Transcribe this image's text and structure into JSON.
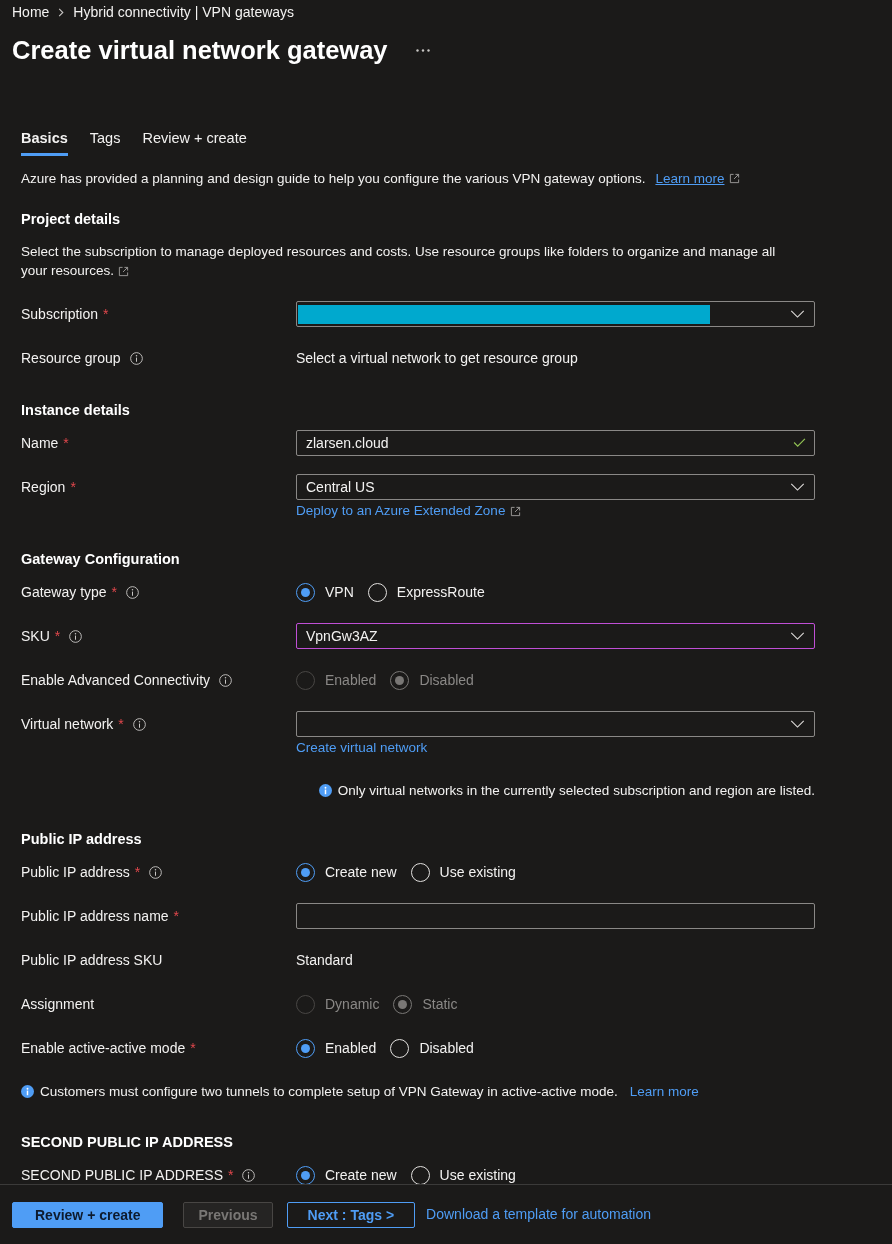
{
  "breadcrumb": [
    {
      "label": "Home"
    },
    {
      "label": "Hybrid connectivity | VPN gateways"
    }
  ],
  "title": "Create virtual network gateway",
  "tabs": [
    {
      "label": "Basics",
      "selected": true
    },
    {
      "label": "Tags",
      "selected": false
    },
    {
      "label": "Review + create",
      "selected": false
    }
  ],
  "intro": {
    "text": "Azure has provided a planning and design guide to help you configure the various VPN gateway options.",
    "link": {
      "label": "Learn more",
      "external": true
    }
  },
  "sections": [
    {
      "heading": "Project details",
      "description": {
        "text": "Select the subscription to manage deployed resources and costs. Use resource groups like folders to organize and manage all your resources.",
        "external": true
      },
      "rows": [
        {
          "kind": "dropdown",
          "label": "Subscription",
          "required_mark": "*",
          "redacted": true
        },
        {
          "kind": "static",
          "label": "Resource group",
          "info": true,
          "value": "Select a virtual network to get resource group"
        }
      ]
    },
    {
      "heading": "Instance details",
      "rows": [
        {
          "kind": "textbox",
          "label": "Name",
          "required_mark": "*",
          "value": "zlarsen.cloud",
          "valid": true
        },
        {
          "kind": "dropdown",
          "label": "Region",
          "required_mark": "*",
          "value": "Central US",
          "link": {
            "label": "Deploy to an Azure Extended Zone",
            "external": true
          }
        }
      ]
    },
    {
      "heading": "Gateway Configuration",
      "rows": [
        {
          "kind": "radio",
          "label": "Gateway type",
          "required_mark": "*",
          "info": true,
          "disabled": false,
          "options": [
            {
              "label": "VPN",
              "selected": true
            },
            {
              "label": "ExpressRoute",
              "selected": false
            }
          ]
        },
        {
          "kind": "dropdown",
          "label": "SKU",
          "required_mark": "*",
          "info": true,
          "value": "VpnGw3AZ",
          "focused": true
        },
        {
          "kind": "radio",
          "label": "Enable Advanced Connectivity",
          "info": true,
          "disabled": true,
          "options": [
            {
              "label": "Enabled",
              "selected": false
            },
            {
              "label": "Disabled",
              "selected": true
            }
          ]
        },
        {
          "kind": "dropdown",
          "label": "Virtual network",
          "required_mark": "*",
          "info": true,
          "link": {
            "label": "Create virtual network"
          },
          "note": {
            "text": "Only virtual networks in the currently selected subscription and region are listed."
          }
        }
      ]
    },
    {
      "heading": "Public IP address",
      "rows": [
        {
          "kind": "radio",
          "label": "Public IP address",
          "required_mark": "*",
          "info": true,
          "disabled": false,
          "options": [
            {
              "label": "Create new",
              "selected": true
            },
            {
              "label": "Use existing",
              "selected": false
            }
          ]
        },
        {
          "kind": "textbox",
          "label": "Public IP address name",
          "required_mark": "*"
        },
        {
          "kind": "static",
          "label": "Public IP address SKU",
          "value": "Standard"
        },
        {
          "kind": "radio",
          "label": "Assignment",
          "disabled": true,
          "options": [
            {
              "label": "Dynamic",
              "selected": false
            },
            {
              "label": "Static",
              "selected": true
            }
          ]
        },
        {
          "kind": "radio",
          "label": "Enable active-active mode",
          "required_mark": "*",
          "disabled": false,
          "options": [
            {
              "label": "Enabled",
              "selected": true
            },
            {
              "label": "Disabled",
              "selected": false
            }
          ]
        },
        {
          "kind": "note",
          "text": "Customers must configure two tunnels to complete setup of VPN Gateway in active-active mode.",
          "link": {
            "label": "Learn more"
          }
        }
      ]
    },
    {
      "heading": "SECOND PUBLIC IP ADDRESS",
      "rows": [
        {
          "kind": "radio",
          "label": "SECOND PUBLIC IP ADDRESS",
          "required_mark": "*",
          "info": true,
          "disabled": false,
          "options": [
            {
              "label": "Create new",
              "selected": true
            },
            {
              "label": "Use existing",
              "selected": false
            }
          ]
        }
      ]
    }
  ],
  "footer": {
    "buttons": [
      {
        "label": "Review + create",
        "kind": "primary",
        "disabled": false
      },
      {
        "label": "Previous",
        "kind": "secondary",
        "disabled": true
      },
      {
        "label": "Next : Tags >",
        "kind": "outline",
        "disabled": false
      }
    ],
    "link": {
      "label": "Download a template for automation"
    }
  }
}
